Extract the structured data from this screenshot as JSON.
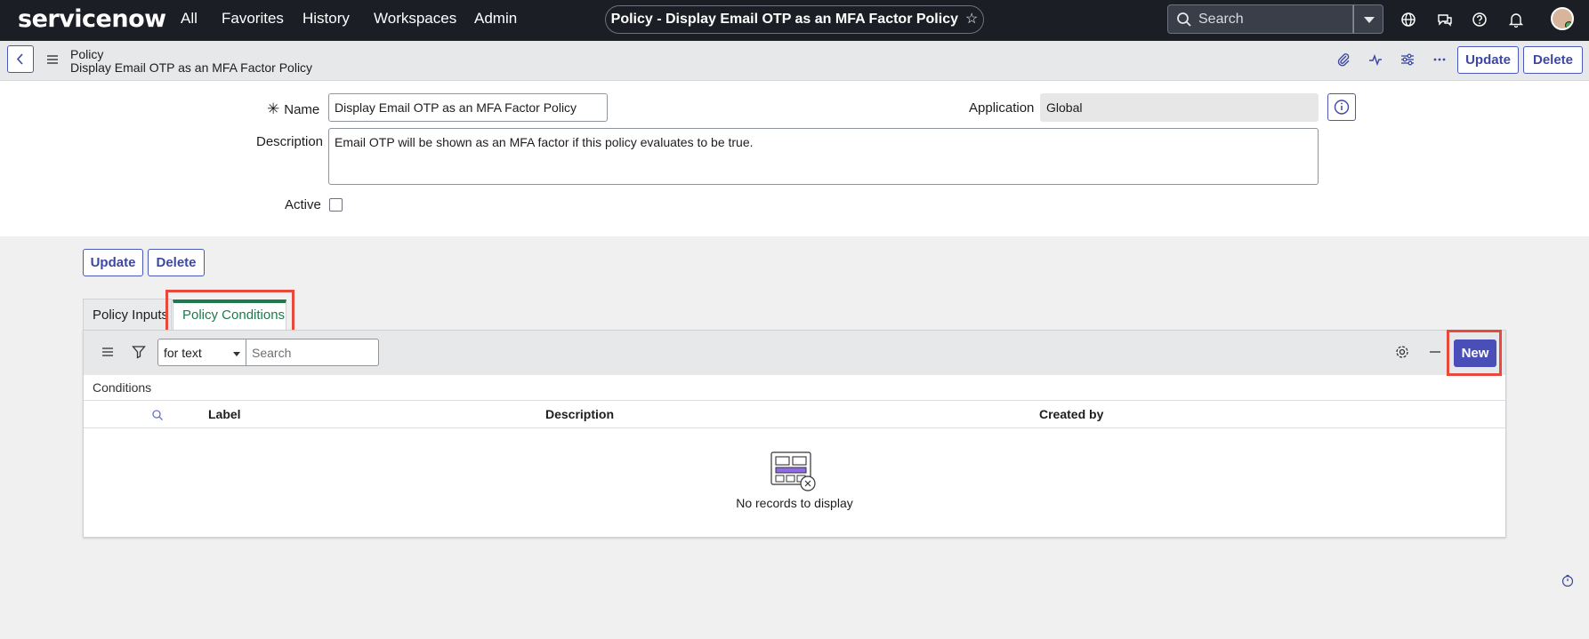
{
  "topnav": {
    "logo": "servicenow",
    "menu": [
      "All",
      "Favorites",
      "History",
      "Workspaces",
      "Admin"
    ],
    "page_title": "Policy - Display Email OTP as an MFA Factor Policy",
    "search_placeholder": "Search"
  },
  "record_header": {
    "type": "Policy",
    "name": "Display Email OTP as an MFA Factor Policy",
    "update_label": "Update",
    "delete_label": "Delete"
  },
  "form": {
    "name_label": "Name",
    "name_value": "Display Email OTP as an MFA Factor Policy",
    "application_label": "Application",
    "application_value": "Global",
    "description_label": "Description",
    "description_value": "Email OTP will be shown as an MFA factor if this policy evaluates to be true.",
    "active_label": "Active",
    "active_checked": false
  },
  "actions": {
    "update_label": "Update",
    "delete_label": "Delete"
  },
  "tabs": [
    {
      "label": "Policy Inputs",
      "active": false
    },
    {
      "label": "Policy Conditions",
      "active": true
    }
  ],
  "related_list": {
    "search_field_option": "for text",
    "search_placeholder": "Search",
    "new_label": "New",
    "caption": "Conditions",
    "columns": [
      "Label",
      "Description",
      "Created by"
    ],
    "empty_message": "No records to display"
  },
  "colors": {
    "nav_bg": "#1b1e25",
    "accent": "#4a4fb8",
    "tab_active": "#1e7a4c",
    "highlight": "#e8493d"
  }
}
